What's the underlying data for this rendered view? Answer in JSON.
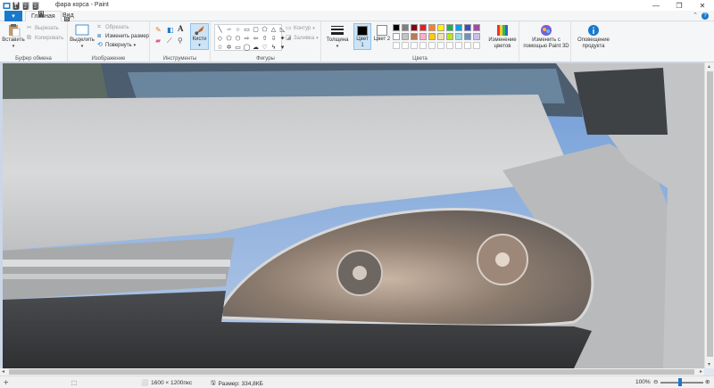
{
  "window": {
    "title": "фара корса - Paint",
    "minimize": "—",
    "maximize": "❐",
    "close": "✕"
  },
  "qat_keytips": [
    "1",
    "2",
    "3"
  ],
  "tabs": {
    "file": "▾",
    "home": "Главная",
    "home_keytip": "H",
    "view": "Вид",
    "view_keytip": "B"
  },
  "ribbon": {
    "clipboard": {
      "label": "Буфер обмена",
      "paste": "Вставить",
      "cut": "Вырезать",
      "copy": "Копировать"
    },
    "image": {
      "label": "Изображение",
      "select": "Выделить",
      "crop": "Обрезать",
      "resize": "Изменить размер",
      "rotate": "Повернуть"
    },
    "tools": {
      "label": "Инструменты",
      "brushes": "Кисти"
    },
    "shapes": {
      "label": "Фигуры",
      "outline": "Контур",
      "fill": "Заливка"
    },
    "colors": {
      "label": "Цвета",
      "size": "Толщина",
      "color1": "Цвет 1",
      "color2": "Цвет 2",
      "edit_colors": "Изменение цветов",
      "paint3d": "Изменить с помощью Paint 3D",
      "product_alert": "Оповещение продукта",
      "color1_value": "#000000",
      "color2_value": "#ffffff",
      "palette_row1": [
        "#000000",
        "#7f7f7f",
        "#880015",
        "#ed1c24",
        "#ff7f27",
        "#fff200",
        "#22b14c",
        "#00a2e8",
        "#3f48cc",
        "#a349a4"
      ],
      "palette_row2": [
        "#ffffff",
        "#c3c3c3",
        "#b97a57",
        "#ffaec9",
        "#ffc90e",
        "#efe4b0",
        "#b5e61d",
        "#99d9ea",
        "#7092be",
        "#c8bfe7"
      ]
    }
  },
  "status": {
    "dimensions": "1600 × 1200пкс",
    "size": "Размер: 334,8КБ",
    "zoom": "100%"
  }
}
